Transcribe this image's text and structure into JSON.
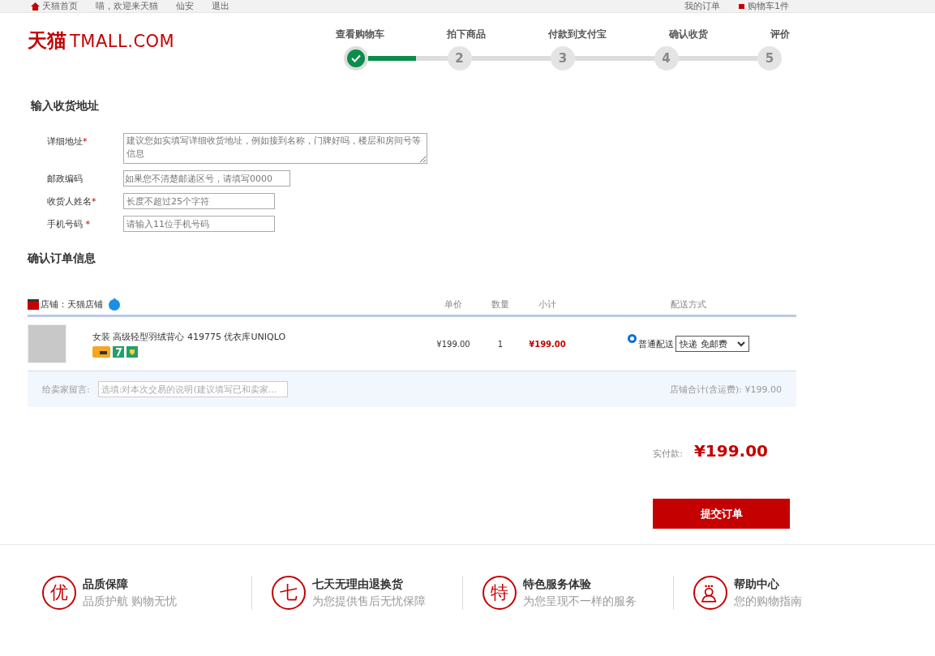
{
  "top_bar": {
    "left_links": [
      "天猫首页",
      "喵，欢迎来天猫",
      "仙安",
      "退出"
    ],
    "right_links": [
      "我的订单",
      "购物车1件"
    ]
  },
  "logo": {
    "brand": "天猫",
    "domain": "TMALL.COM"
  },
  "steps": [
    {
      "label": "查看购物车",
      "done": true
    },
    {
      "label": "拍下商品",
      "number": "2",
      "done": false
    },
    {
      "label": "付款到支付宝",
      "number": "3",
      "done": false
    },
    {
      "label": "确认收货",
      "number": "4",
      "done": false
    },
    {
      "label": "评价",
      "number": "5",
      "done": false
    }
  ],
  "address": {
    "title": "输入收货地址",
    "fields": [
      {
        "label": "详细地址",
        "required_mark": "*",
        "kind": "textarea",
        "placeholder": "建议您如实填写详细收货地址，例如接到名称，门牌好吗，楼层和房间号等信息"
      },
      {
        "label": "邮政编码",
        "kind": "input",
        "placeholder": "如果您不清楚邮递区号，请填写0000"
      },
      {
        "label": "收货人姓名",
        "required_mark": "*",
        "kind": "input",
        "placeholder": "长度不超过25个字符"
      },
      {
        "label": "手机号码",
        "required_mark": "*",
        "kind": "input",
        "placeholder": "请输入11位手机号码"
      }
    ]
  },
  "order": {
    "title": "确认订单信息",
    "shop": "店铺：天猫店铺",
    "columns": [
      "单价",
      "数量",
      "小计",
      "配送方式"
    ],
    "item": {
      "name": "女装 高级轻型羽绒背心 419775 优衣库UNIQLO",
      "unit_price": "¥199.00",
      "quantity": "1",
      "subtotal": "¥199.00",
      "shipping_option": "普通配送",
      "shipping_selected": true,
      "shipping_method": "快递 免邮费"
    },
    "message_label": "给卖家留言:",
    "message_placeholder": "选填:对本次交易的说明(建议填写已和卖家...",
    "shop_total": "店铺合计(含运费): ¥199.00"
  },
  "payment": {
    "label": "实付款:",
    "amount": "¥199.00"
  },
  "submit_button": "提交订单",
  "footer": [
    {
      "glyph": "优",
      "kind": "glyph",
      "title": "品质保障",
      "subtitle": "品质护航 购物无忧"
    },
    {
      "glyph": "七",
      "kind": "glyph",
      "title": "七天无理由退换货",
      "subtitle": "为您提供售后无忧保障"
    },
    {
      "glyph": "特",
      "kind": "glyph",
      "title": "特色服务体验",
      "subtitle": "为您呈现不一样的服务"
    },
    {
      "kind": "person",
      "title": "帮助中心",
      "subtitle": "您的购物指南"
    }
  ]
}
